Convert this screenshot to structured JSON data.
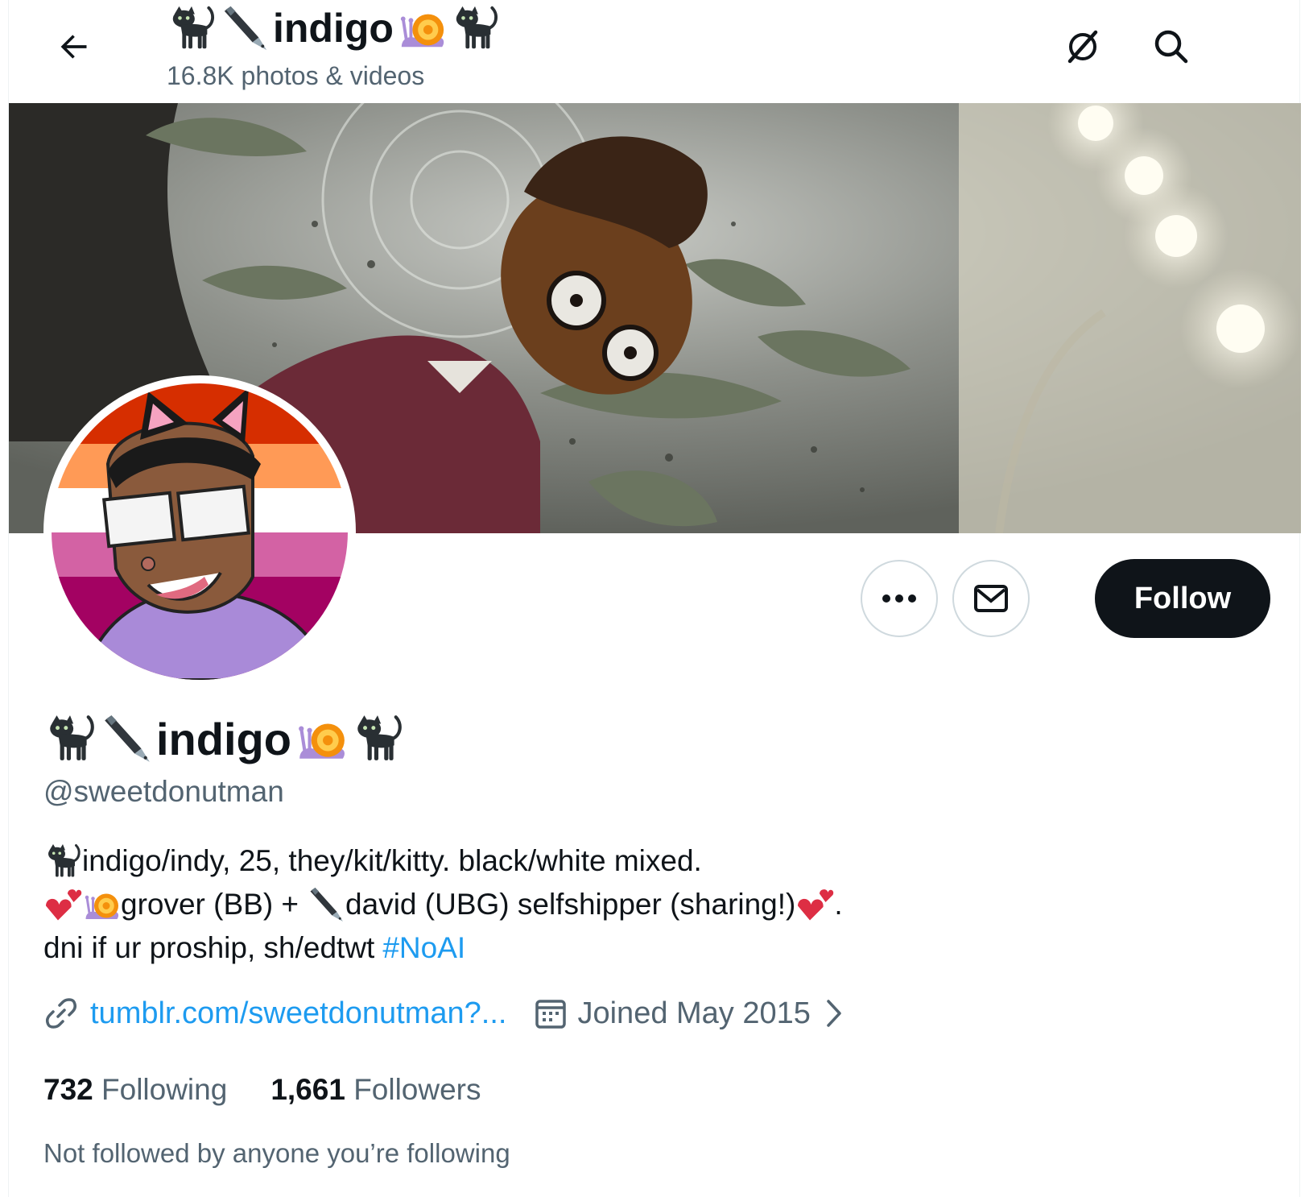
{
  "header": {
    "name_text": "indigo",
    "media_count": "16.8K photos & videos"
  },
  "profile": {
    "name_text": "indigo",
    "handle": "@sweetdonutman"
  },
  "actions": {
    "follow_label": "Follow"
  },
  "bio": {
    "line1": "indigo/indy, 25, they/kit/kitty. black/white mixed.",
    "line2a": "grover (BB) +",
    "line2b": "david (UBG) selfshipper (sharing!)",
    "line2c": ".",
    "line3": "dni if ur proship, sh/edtwt",
    "hashtag": "#NoAI"
  },
  "meta": {
    "link": "tumblr.com/sweetdonutman?...",
    "joined": "Joined May 2015"
  },
  "stats": {
    "following_count": "732",
    "following_label": "Following",
    "followers_count": "1,661",
    "followers_label": "Followers"
  },
  "mutuals_text": "Not followed by anyone you’re following",
  "colors": {
    "accent": "#1d9bf0",
    "text": "#0f1419",
    "muted": "#536471",
    "follow_bg": "#0f1419"
  },
  "icons": [
    "back-arrow-icon",
    "grok-icon",
    "search-icon",
    "more-icon",
    "envelope-icon",
    "link-icon",
    "calendar-icon",
    "chevron-right-icon",
    "black-cat-emoji",
    "pen-emoji",
    "snail-emoji",
    "hearts-emoji"
  ]
}
